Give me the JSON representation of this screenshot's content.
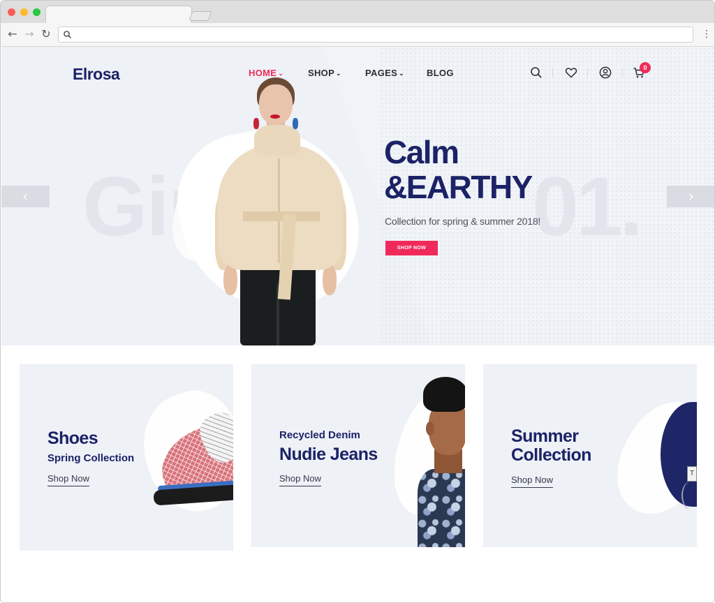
{
  "browser": {
    "address_value": "",
    "icons": {
      "back": "arrow-left-icon",
      "forward": "arrow-right-icon",
      "reload": "reload-icon",
      "search": "search-icon",
      "menu": "kebab-menu-icon"
    }
  },
  "header": {
    "logo": "Elrosa",
    "nav": [
      {
        "label": "HOME",
        "has_dropdown": true,
        "active": true
      },
      {
        "label": "SHOP",
        "has_dropdown": true,
        "active": false
      },
      {
        "label": "PAGES",
        "has_dropdown": true,
        "active": false
      },
      {
        "label": "BLOG",
        "has_dropdown": false,
        "active": false
      }
    ],
    "caret": "⌄",
    "icons": [
      "search-icon",
      "heart-icon",
      "user-icon",
      "cart-icon"
    ],
    "cart_count": "0"
  },
  "hero": {
    "background_word": "Gir",
    "background_number": "01.",
    "title_line1": "Calm",
    "title_line2": "&EARTHY",
    "subtitle": "Collection for spring & summer 2018!",
    "button_label": "SHOP NOW",
    "prev_arrow": "‹",
    "next_arrow": "›"
  },
  "banners": [
    {
      "title": "Shoes",
      "subtitle": "Spring Collection",
      "link": "Shop Now"
    },
    {
      "overline": "Recycled Denim",
      "title": "Nudie Jeans",
      "link": "Shop Now"
    },
    {
      "title_line1": "Summer",
      "title_line2": "Collection",
      "link": "Shop Now"
    }
  ],
  "colors": {
    "brand_navy": "#1b2266",
    "accent_pink": "#ee2d59",
    "hero_bg": "#eef1f6"
  }
}
